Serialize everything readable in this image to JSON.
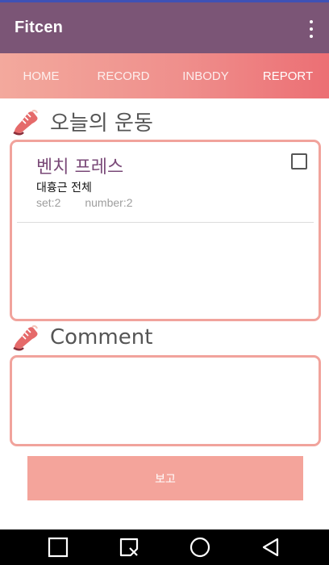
{
  "app": {
    "title": "Fitcen"
  },
  "tabs": [
    {
      "label": "HOME"
    },
    {
      "label": "RECORD"
    },
    {
      "label": "INBODY"
    },
    {
      "label": "REPORT",
      "active": true
    }
  ],
  "workout": {
    "section_title": "오늘의 운동",
    "items": [
      {
        "name": "벤치 프레스",
        "category": "대흉근 전체",
        "set_text": "set:2",
        "number_text": "number:2",
        "checked": false
      }
    ]
  },
  "comment": {
    "section_title": "Comment",
    "value": ""
  },
  "report_button": {
    "label": "보고"
  },
  "colors": {
    "appbar": "#7b5576",
    "tab_start": "#f3a99d",
    "tab_end": "#ec6f74",
    "card_border": "#f1a39c",
    "button": "#f4a49b",
    "exercise_name": "#7a4a78"
  },
  "icons": {
    "section": "running-shoe-icon",
    "menu": "overflow-menu-icon",
    "nav": [
      "square-icon",
      "screenshot-icon",
      "home-circle-icon",
      "back-triangle-icon"
    ]
  }
}
